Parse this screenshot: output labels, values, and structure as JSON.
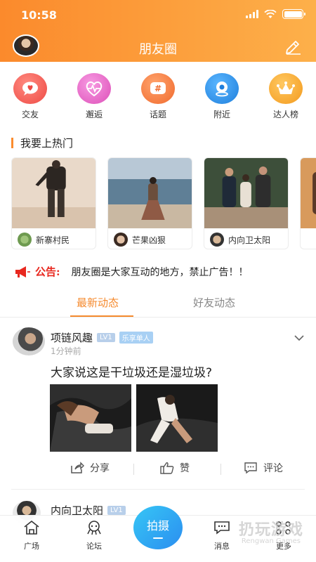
{
  "status": {
    "time": "10:58"
  },
  "header": {
    "title": "朋友圈"
  },
  "categories": [
    {
      "label": "交友",
      "icon": "heart-chat-icon",
      "color": "#f2554f"
    },
    {
      "label": "邂逅",
      "icon": "heartbeat-icon",
      "color": "#e95ec5"
    },
    {
      "label": "话题",
      "icon": "hashtag-icon",
      "color": "#f57a3c"
    },
    {
      "label": "附近",
      "icon": "location-icon",
      "color": "#2b8de6"
    },
    {
      "label": "达人榜",
      "icon": "crown-icon",
      "color": "#f6a428"
    }
  ],
  "hot": {
    "title": "我要上热门",
    "cards": [
      {
        "name": "新寨村民"
      },
      {
        "name": "芒果凶狠"
      },
      {
        "name": "内向卫太阳"
      }
    ]
  },
  "notice": {
    "label": "公告:",
    "text": "朋友圈是大家互动的地方，禁止广告！！"
  },
  "tabs": {
    "active": "最新动态",
    "inactive": "好友动态"
  },
  "post": {
    "name": "项链风趣",
    "level": "LV1",
    "tag": "乐享单人",
    "time": "1分钟前",
    "text": "大家说这是干垃圾还是湿垃圾?",
    "actions": {
      "share": "分享",
      "like": "赞",
      "comment": "评论"
    }
  },
  "post2": {
    "name": "内向卫太阳",
    "level": "LV1"
  },
  "nav": {
    "square": "广场",
    "forum": "论坛",
    "shoot": "拍摄",
    "message": "消息",
    "more": "更多"
  },
  "watermark": {
    "main": "扔玩游戏",
    "sub": "Rengwan Games"
  },
  "colors": {
    "accent": "#f58a2e",
    "header_start": "#fb8a2c",
    "header_end": "#fdb04a",
    "shoot": "#2b8ef0",
    "notice": "#e8281f"
  }
}
